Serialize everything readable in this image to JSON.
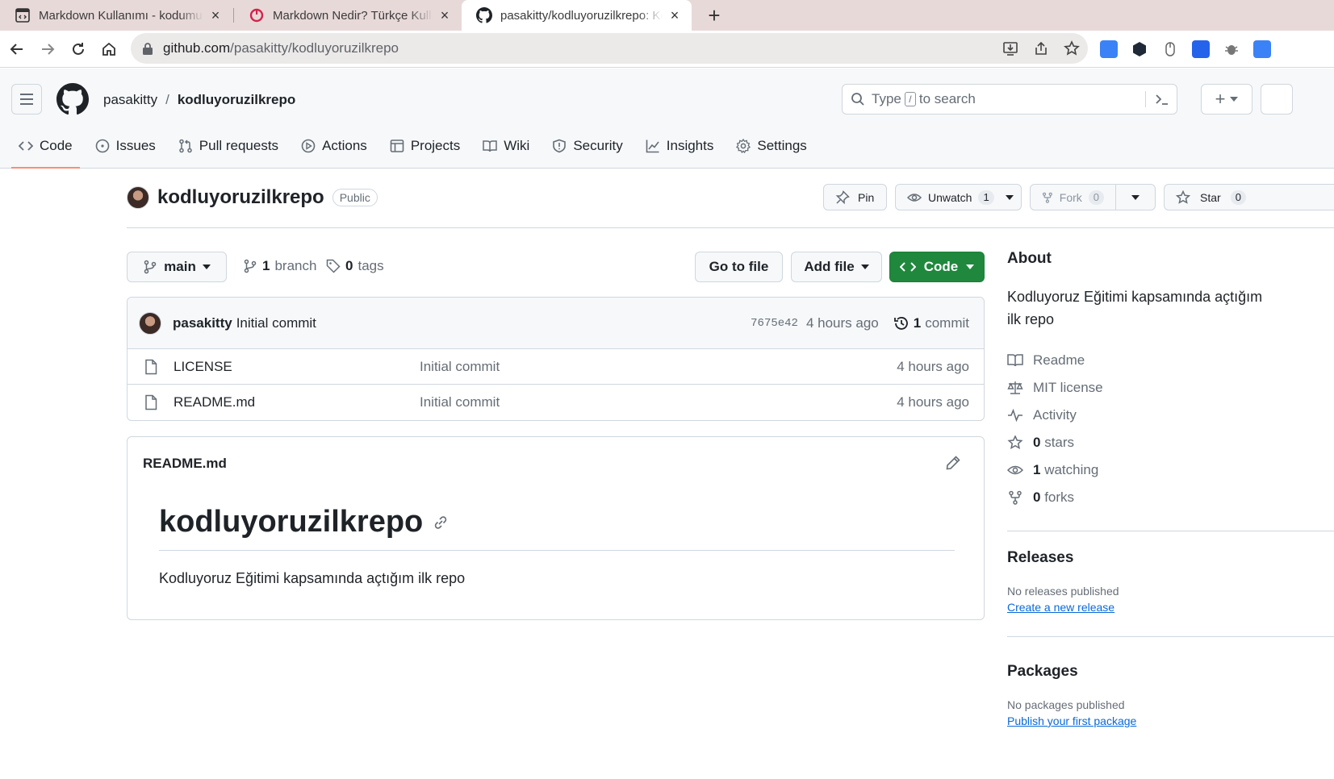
{
  "browser": {
    "tabs": [
      {
        "title": "Markdown Kullanımı - kodumun",
        "icon": "code-file-icon"
      },
      {
        "title": "Markdown Nedir? Türkçe Kullanım",
        "icon": "red-brand-icon"
      },
      {
        "title": "pasakitty/kodluyoruzilkrepo: Kodluyoruz",
        "icon": "github-icon"
      }
    ],
    "url_host": "github.com",
    "url_path": "/pasakitty/kodluyoruzilkrepo"
  },
  "header": {
    "owner": "pasakitty",
    "separator": "/",
    "repo": "kodluyoruzilkrepo",
    "search_prefix": "Type",
    "search_key": "/",
    "search_suffix": "to search",
    "plus": "+"
  },
  "nav": [
    {
      "label": "Code",
      "icon": "code-icon"
    },
    {
      "label": "Issues",
      "icon": "issue-icon"
    },
    {
      "label": "Pull requests",
      "icon": "pull-request-icon"
    },
    {
      "label": "Actions",
      "icon": "play-icon"
    },
    {
      "label": "Projects",
      "icon": "table-icon"
    },
    {
      "label": "Wiki",
      "icon": "book-icon"
    },
    {
      "label": "Security",
      "icon": "shield-icon"
    },
    {
      "label": "Insights",
      "icon": "graph-icon"
    },
    {
      "label": "Settings",
      "icon": "gear-icon"
    }
  ],
  "repo": {
    "name": "kodluyoruzilkrepo",
    "visibility": "Public",
    "pin": "Pin",
    "unwatch": "Unwatch",
    "watch_count": "1",
    "fork": "Fork",
    "fork_count": "0",
    "star": "Star",
    "star_count": "0"
  },
  "files": {
    "branch": "main",
    "branch_count": "1",
    "branch_word": "branch",
    "tag_count": "0",
    "tag_word": "tags",
    "go_to_file": "Go to file",
    "add_file": "Add file",
    "code": "Code",
    "commit": {
      "author": "pasakitty",
      "message": "Initial commit",
      "sha": "7675e42",
      "age": "4 hours ago",
      "count": "1",
      "count_word": "commit"
    },
    "rows": [
      {
        "name": "LICENSE",
        "message": "Initial commit",
        "age": "4 hours ago"
      },
      {
        "name": "README.md",
        "message": "Initial commit",
        "age": "4 hours ago"
      }
    ]
  },
  "readme": {
    "filename": "README.md",
    "heading": "kodluyoruzilkrepo",
    "body": "Kodluyoruz Eğitimi kapsamında açtığım ilk repo"
  },
  "sidebar": {
    "about_title": "About",
    "description": "Kodluyoruz Eğitimi kapsamında açtığım\nilk repo",
    "description_line1": "Kodluyoruz Eğitimi kapsamında açtığım",
    "description_line2": "ilk repo",
    "items": [
      {
        "num": "",
        "label": "Readme",
        "icon": "book-icon"
      },
      {
        "num": "",
        "label": "MIT license",
        "icon": "law-icon"
      },
      {
        "num": "",
        "label": "Activity",
        "icon": "pulse-icon"
      },
      {
        "num": "0",
        "label": "stars",
        "icon": "star-icon"
      },
      {
        "num": "1",
        "label": "watching",
        "icon": "eye-icon"
      },
      {
        "num": "0",
        "label": "forks",
        "icon": "fork-icon"
      }
    ],
    "releases_title": "Releases",
    "releases_text": "No releases published",
    "releases_link": "Create a new release",
    "packages_title": "Packages",
    "packages_text": "No packages published",
    "packages_link": "Publish your first package"
  },
  "colors": {
    "accent_green": "#1f883d",
    "nav_underline": "#fd8c73",
    "link_blue": "#0969da"
  }
}
